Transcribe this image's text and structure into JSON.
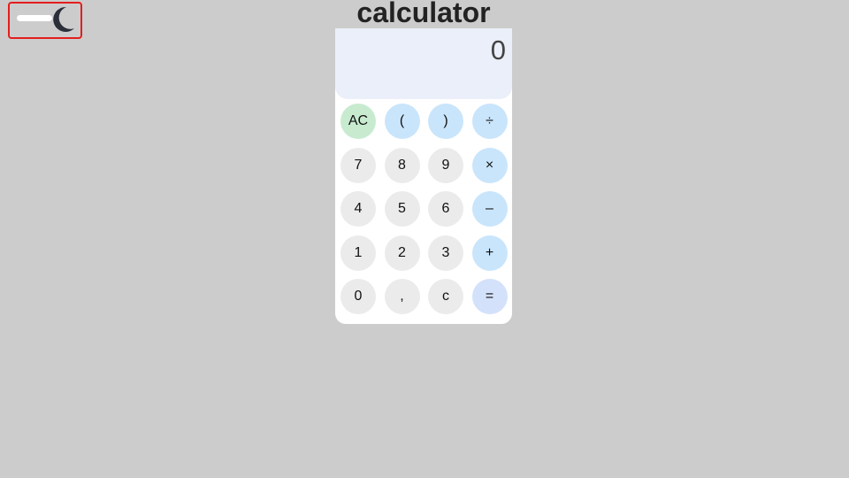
{
  "app": {
    "title": "calculator"
  },
  "theme_toggle": {
    "icon": "moon-icon",
    "highlight_color": "#e51d1d"
  },
  "display": {
    "value": "0"
  },
  "keys": [
    {
      "label": "AC",
      "type": "clear",
      "name": "key-ac"
    },
    {
      "label": "(",
      "type": "op",
      "name": "key-open-paren"
    },
    {
      "label": ")",
      "type": "op",
      "name": "key-close-paren"
    },
    {
      "label": "÷",
      "type": "op",
      "name": "key-divide"
    },
    {
      "label": "7",
      "type": "digit",
      "name": "key-7"
    },
    {
      "label": "8",
      "type": "digit",
      "name": "key-8"
    },
    {
      "label": "9",
      "type": "digit",
      "name": "key-9"
    },
    {
      "label": "×",
      "type": "op",
      "name": "key-multiply"
    },
    {
      "label": "4",
      "type": "digit",
      "name": "key-4"
    },
    {
      "label": "5",
      "type": "digit",
      "name": "key-5"
    },
    {
      "label": "6",
      "type": "digit",
      "name": "key-6"
    },
    {
      "label": "–",
      "type": "op",
      "name": "key-subtract"
    },
    {
      "label": "1",
      "type": "digit",
      "name": "key-1"
    },
    {
      "label": "2",
      "type": "digit",
      "name": "key-2"
    },
    {
      "label": "3",
      "type": "digit",
      "name": "key-3"
    },
    {
      "label": "+",
      "type": "op",
      "name": "key-add"
    },
    {
      "label": "0",
      "type": "digit",
      "name": "key-0"
    },
    {
      "label": ",",
      "type": "digit",
      "name": "key-decimal"
    },
    {
      "label": "c",
      "type": "digit",
      "name": "key-backspace"
    },
    {
      "label": "=",
      "type": "eq",
      "name": "key-equals"
    }
  ],
  "colors": {
    "background": "#cccccc",
    "display_bg": "#ebeff9",
    "digit_key": "#ebebeb",
    "operator_key": "#c9e5fb",
    "clear_key": "#c8ebd0",
    "equals_key": "#d4e1fa"
  }
}
